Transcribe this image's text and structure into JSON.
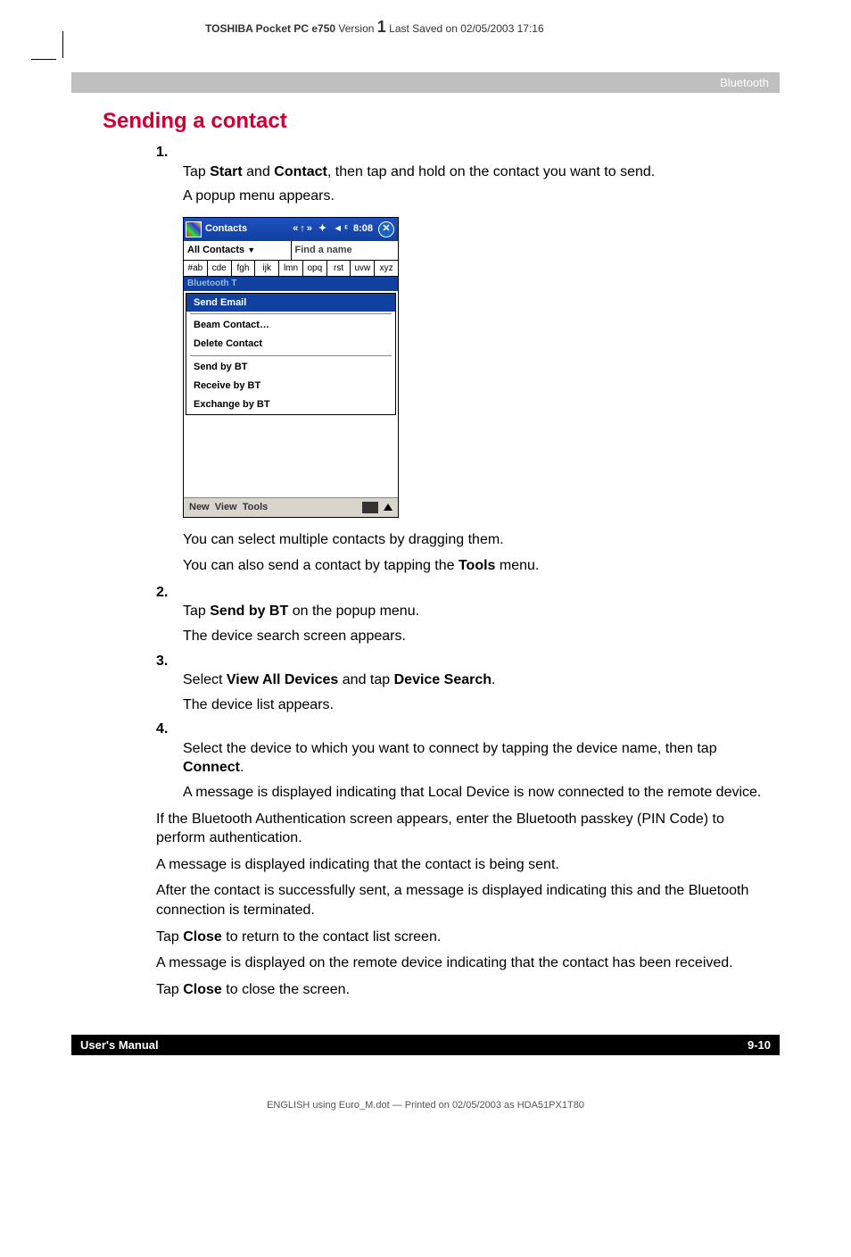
{
  "header": {
    "product": "TOSHIBA Pocket PC e750",
    "version_label": "Version",
    "version_num": "1",
    "saved": "Last Saved on 02/05/2003 17:16"
  },
  "breadcrumb": "Bluetooth",
  "section_title": "Sending a contact",
  "steps": [
    {
      "num": "1.",
      "text_parts": [
        "Tap ",
        "Start",
        " and ",
        "Contact",
        ", then tap and hold on the contact you want to send."
      ],
      "sub": "A popup menu appears."
    }
  ],
  "post_shot": {
    "line1": "You can select multiple contacts by dragging them.",
    "line2_pre": "You can also send a contact by tapping the ",
    "line2_bold": "Tools",
    "line2_post": " menu."
  },
  "steps2": [
    {
      "num": "2.",
      "pre": "Tap ",
      "b1": "Send by BT",
      "post": " on the popup menu.",
      "sub": "The device search screen appears."
    },
    {
      "num": "3.",
      "pre": "Select ",
      "b1": "View All Devices",
      "mid": " and tap ",
      "b2": "Device Search",
      "post": ".",
      "sub": "The device list appears."
    },
    {
      "num": "4.",
      "pre": "Select the device to which you want to connect by tapping the device name, then tap ",
      "b1": "Connect",
      "post": ".",
      "sub": "A message is displayed indicating that Local Device is now connected to the remote device."
    }
  ],
  "paras": [
    "If the Bluetooth Authentication screen appears, enter the Bluetooth passkey (PIN Code) to perform authentication.",
    "A message is displayed indicating that the contact is being sent.",
    "After the contact is successfully sent, a message is displayed indicating this and the Bluetooth connection is terminated."
  ],
  "close1_pre": "Tap ",
  "close1_b": "Close",
  "close1_post": " to return to the contact list screen.",
  "para_remote": "A message is displayed on the remote device indicating that the contact has been received.",
  "close2_pre": "Tap ",
  "close2_b": "Close",
  "close2_post": " to close the screen.",
  "footer": {
    "left": "User's Manual",
    "right": "9-10"
  },
  "print_footer": "ENGLISH using Euro_M.dot — Printed on 02/05/2003 as HDA51PX1T80",
  "shot": {
    "title": "Contacts",
    "time": "8:08",
    "signal": "«↑» ✦ ◄ᵋ",
    "close": "✕",
    "all": "All Contacts",
    "find": "Find a name",
    "alpha": [
      "#ab",
      "cde",
      "fgh",
      "ijk",
      "lmn",
      "opq",
      "rst",
      "uvw",
      "xyz"
    ],
    "bt": "Bluetooth  T",
    "menu": {
      "sel": "Send Email",
      "items": [
        "Beam Contact…",
        "Delete Contact"
      ],
      "items2": [
        "Send by BT",
        "Receive by BT",
        "Exchange by BT"
      ]
    },
    "menubar": {
      "new": "New",
      "view": "View",
      "tools": "Tools"
    }
  }
}
